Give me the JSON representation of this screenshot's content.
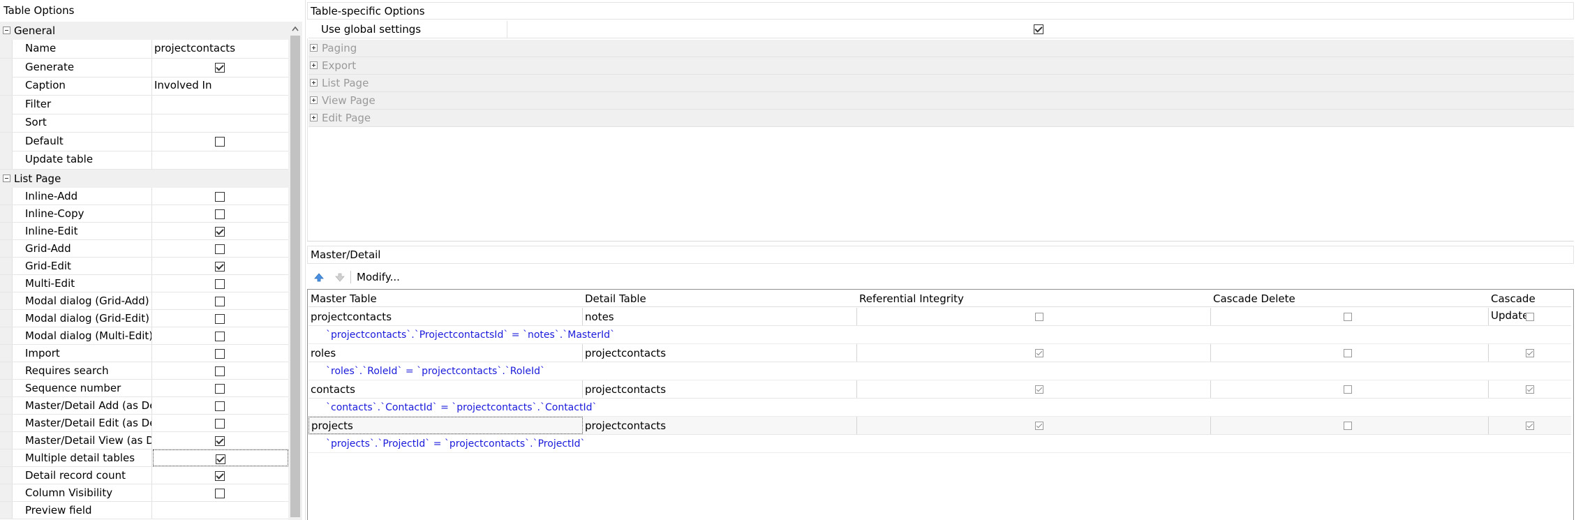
{
  "left_panel": {
    "title": "Table Options",
    "groups": [
      {
        "label": "General",
        "rows": [
          {
            "label": "Name",
            "value": "projectcontacts",
            "type": "text"
          },
          {
            "label": "Generate",
            "type": "checkbox",
            "checked": true
          },
          {
            "label": "Caption",
            "value": "Involved In",
            "type": "text"
          },
          {
            "label": "Filter",
            "value": "",
            "type": "text"
          },
          {
            "label": "Sort",
            "value": "",
            "type": "text"
          },
          {
            "label": "Default",
            "type": "checkbox",
            "checked": false
          },
          {
            "label": "Update table",
            "value": "",
            "type": "text"
          }
        ]
      },
      {
        "label": "List Page",
        "rows": [
          {
            "label": "Inline-Add",
            "type": "checkbox",
            "checked": false
          },
          {
            "label": "Inline-Copy",
            "type": "checkbox",
            "checked": false
          },
          {
            "label": "Inline-Edit",
            "type": "checkbox",
            "checked": true
          },
          {
            "label": "Grid-Add",
            "type": "checkbox",
            "checked": false
          },
          {
            "label": "Grid-Edit",
            "type": "checkbox",
            "checked": true
          },
          {
            "label": "Multi-Edit",
            "type": "checkbox",
            "checked": false
          },
          {
            "label": "Modal dialog (Grid-Add)",
            "type": "checkbox",
            "checked": false
          },
          {
            "label": "Modal dialog (Grid-Edit)",
            "type": "checkbox",
            "checked": false
          },
          {
            "label": "Modal dialog (Multi-Edit)",
            "type": "checkbox",
            "checked": false
          },
          {
            "label": "Import",
            "type": "checkbox",
            "checked": false
          },
          {
            "label": "Requires search",
            "type": "checkbox",
            "checked": false
          },
          {
            "label": "Sequence number",
            "type": "checkbox",
            "checked": false
          },
          {
            "label": "Master/Detail Add (as Deta",
            "type": "checkbox",
            "checked": false
          },
          {
            "label": "Master/Detail Edit (as Detai",
            "type": "checkbox",
            "checked": false
          },
          {
            "label": "Master/Detail View (as Deta",
            "type": "checkbox",
            "checked": true
          },
          {
            "label": "Multiple detail tables",
            "type": "checkbox",
            "checked": true,
            "selected": true
          },
          {
            "label": "Detail record count",
            "type": "checkbox",
            "checked": true
          },
          {
            "label": "Column Visibility",
            "type": "checkbox",
            "checked": false
          },
          {
            "label": "Preview field",
            "value": "",
            "type": "text"
          }
        ]
      }
    ]
  },
  "right_panel": {
    "title": "Table-specific Options",
    "use_global_label": "Use global settings",
    "use_global_checked": true,
    "collapsed_sections": [
      "Paging",
      "Export",
      "List Page",
      "View Page",
      "Edit Page"
    ]
  },
  "master_detail": {
    "title": "Master/Detail",
    "modify_label": "Modify...",
    "columns": [
      "Master Table",
      "Detail Table",
      "Referential Integrity",
      "Cascade Delete",
      "Cascade Update"
    ],
    "rows": [
      {
        "master": "projectcontacts",
        "detail": "notes",
        "ri": false,
        "cd": false,
        "cu": false,
        "join": "`projectcontacts`.`ProjectcontactsId` = `notes`.`MasterId`"
      },
      {
        "master": "roles",
        "detail": "projectcontacts",
        "ri": true,
        "cd": false,
        "cu": true,
        "join": "`roles`.`RoleId` = `projectcontacts`.`RoleId`"
      },
      {
        "master": "contacts",
        "detail": "projectcontacts",
        "ri": true,
        "cd": false,
        "cu": true,
        "join": "`contacts`.`ContactId` = `projectcontacts`.`ContactId`"
      },
      {
        "master": "projects",
        "detail": "projectcontacts",
        "ri": true,
        "cd": false,
        "cu": true,
        "join": "`projects`.`ProjectId` = `projectcontacts`.`ProjectId`",
        "selected": true
      }
    ]
  }
}
